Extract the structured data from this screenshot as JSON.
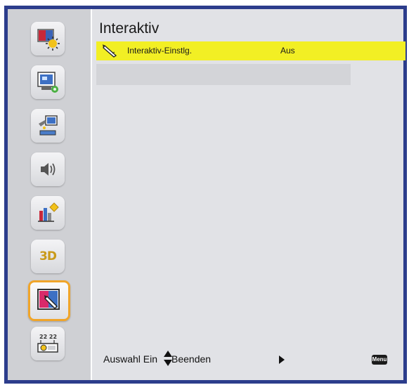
{
  "menu": {
    "title": "Interaktiv",
    "rows": [
      {
        "label": "Interaktiv-Einstlg.",
        "value": "Aus",
        "icon": "pen-icon",
        "highlighted": true
      }
    ]
  },
  "sidebar": {
    "items": [
      {
        "name": "image-settings",
        "icon": "image-settings-icon"
      },
      {
        "name": "display",
        "icon": "display-icon"
      },
      {
        "name": "setup",
        "icon": "setup-icon"
      },
      {
        "name": "audio",
        "icon": "speaker-icon"
      },
      {
        "name": "options",
        "icon": "options-icon"
      },
      {
        "name": "3d",
        "icon": "3d-icon",
        "label": "3D"
      },
      {
        "name": "interactive",
        "icon": "interactive-icon",
        "selected": true
      },
      {
        "name": "network",
        "icon": "network-icon"
      }
    ]
  },
  "footer": {
    "select_text": "Auswahl Ein",
    "exit_text": "Beenden",
    "menu_key_label": "Menu"
  },
  "colors": {
    "frame": "#2c3d8c",
    "highlight": "#f2ef24",
    "selected_border": "#f0a52a",
    "panel": "#e1e2e6",
    "sidebar": "#cfd0d4"
  }
}
